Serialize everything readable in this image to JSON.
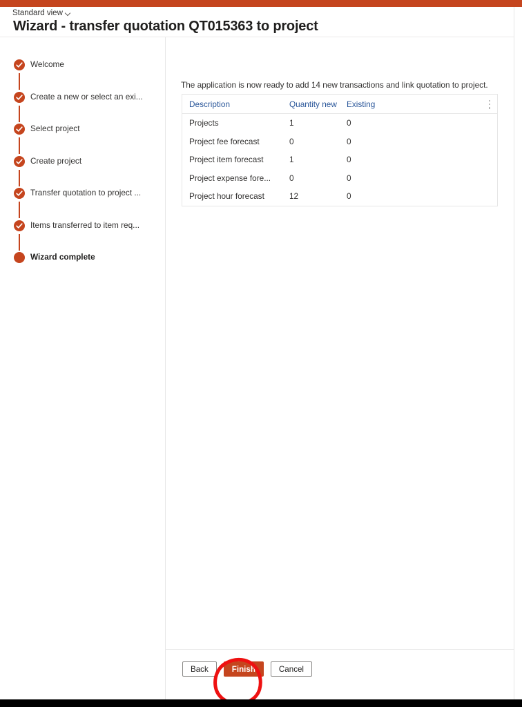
{
  "window": {
    "accent_color": "#c5451e",
    "view_selector_label": "Standard view",
    "title": "Wizard - transfer quotation QT015363 to project"
  },
  "sidebar": {
    "steps": [
      {
        "label": "Welcome",
        "state": "completed"
      },
      {
        "label": "Create a new or select an exi...",
        "state": "completed"
      },
      {
        "label": "Select project",
        "state": "completed"
      },
      {
        "label": "Create project",
        "state": "completed"
      },
      {
        "label": "Transfer quotation to project ...",
        "state": "completed"
      },
      {
        "label": "Items transferred to item req...",
        "state": "completed"
      },
      {
        "label": "Wizard complete",
        "state": "current"
      }
    ]
  },
  "content": {
    "intro_text": "The application is now ready to add 14 new transactions and link quotation to project.",
    "grid": {
      "columns": [
        "Description",
        "Quantity new",
        "Existing"
      ],
      "rows": [
        {
          "description": "Projects",
          "quantity_new": "1",
          "existing": "0"
        },
        {
          "description": "Project fee forecast",
          "quantity_new": "0",
          "existing": "0"
        },
        {
          "description": "Project item forecast",
          "quantity_new": "1",
          "existing": "0"
        },
        {
          "description": "Project expense fore...",
          "quantity_new": "0",
          "existing": "0"
        },
        {
          "description": "Project hour forecast",
          "quantity_new": "12",
          "existing": "0"
        }
      ]
    }
  },
  "footer": {
    "back_label": "Back",
    "finish_label": "Finish",
    "cancel_label": "Cancel"
  },
  "annotation": {
    "color": "#ee1111",
    "target": "finish-button"
  }
}
